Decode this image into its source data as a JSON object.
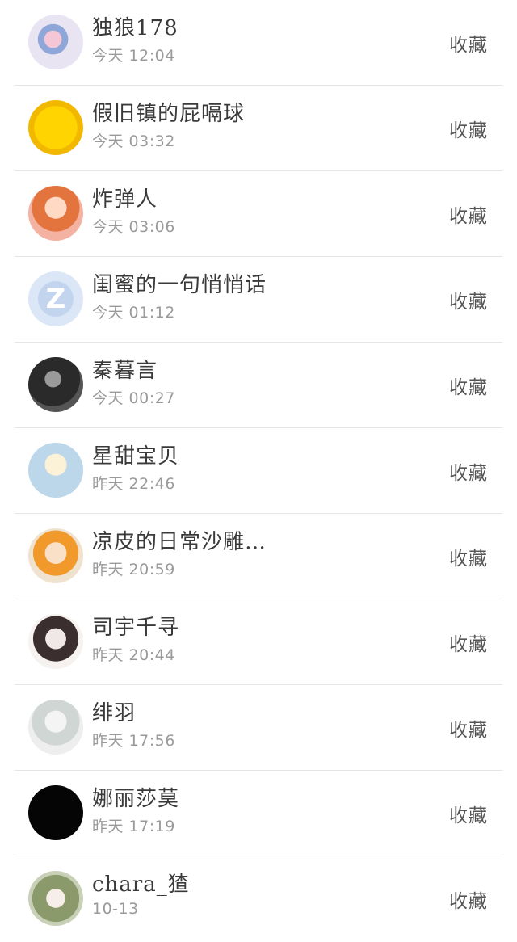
{
  "contacts": [
    {
      "name": "独狼178",
      "time": "今天 12:04",
      "action": "收藏",
      "avatar": "art-avatar"
    },
    {
      "name": "假旧镇的屁嗝球",
      "time": "今天 03:32",
      "action": "收藏",
      "avatar": "troll-face-avatar"
    },
    {
      "name": "炸弹人",
      "time": "今天 03:06",
      "action": "收藏",
      "avatar": "anime-girl-avatar"
    },
    {
      "name": "闺蜜的一句悄悄话",
      "time": "今天 01:12",
      "action": "收藏",
      "avatar": "qzone-logo-avatar",
      "logo_text": "Z"
    },
    {
      "name": "秦暮言",
      "time": "今天 00:27",
      "action": "收藏",
      "avatar": "dark-photo-avatar"
    },
    {
      "name": "星甜宝贝",
      "time": "昨天 22:46",
      "action": "收藏",
      "avatar": "anime-boy-avatar"
    },
    {
      "name": "凉皮的日常沙雕…",
      "time": "昨天 20:59",
      "action": "收藏",
      "avatar": "orange-hair-avatar"
    },
    {
      "name": "司宇千寻",
      "time": "昨天 20:44",
      "action": "收藏",
      "avatar": "sketch-avatar"
    },
    {
      "name": "绯羽",
      "time": "昨天 17:56",
      "action": "收藏",
      "avatar": "grey-anime-avatar"
    },
    {
      "name": "娜丽莎莫",
      "time": "昨天 17:19",
      "action": "收藏",
      "avatar": "black-avatar"
    },
    {
      "name": "chara_猹",
      "time": "10-13",
      "action": "收藏",
      "avatar": "hood-anime-avatar"
    }
  ]
}
